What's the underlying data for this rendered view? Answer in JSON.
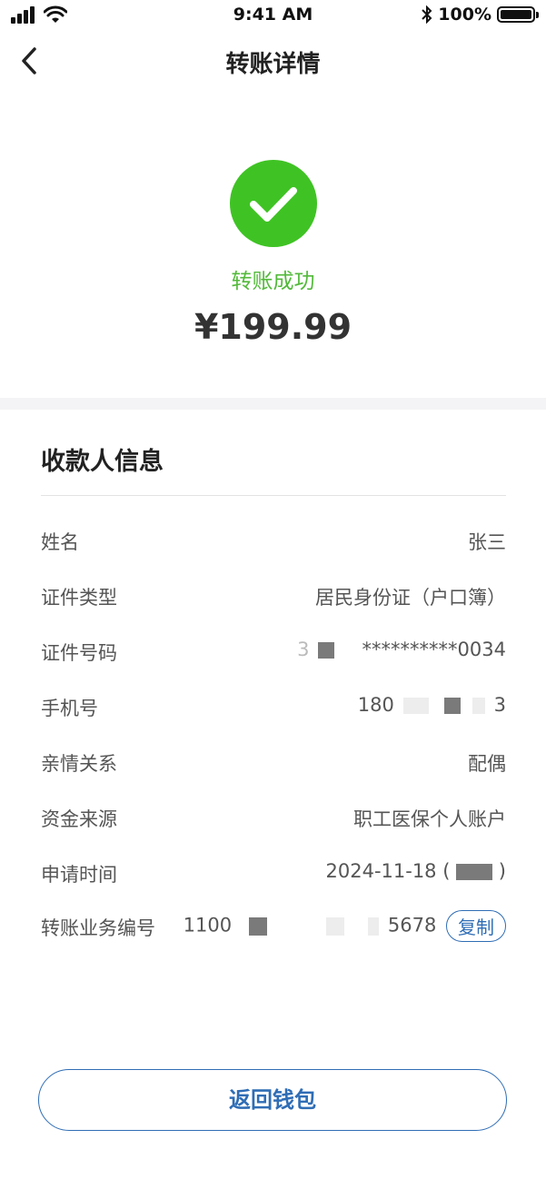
{
  "status_bar": {
    "time": "9:41 AM",
    "battery_percent": "100%",
    "battery_level": 1.0
  },
  "nav": {
    "title": "转账详情"
  },
  "result": {
    "status": "转账成功",
    "amount": "¥199.99"
  },
  "payee_section": {
    "title": "收款人信息"
  },
  "rows": [
    {
      "label": "姓名",
      "value": "张三"
    },
    {
      "label": "证件类型",
      "value": "居民身份证（户口簿）"
    },
    {
      "label": "证件号码",
      "value_prefix": "3",
      "value_suffix": "**********0034"
    },
    {
      "label": "手机号",
      "value_prefix": "180",
      "value_suffix": "3"
    },
    {
      "label": "亲情关系",
      "value": "配偶"
    },
    {
      "label": "资金来源",
      "value": "职工医保个人账户"
    },
    {
      "label": "申请时间",
      "value_prefix": "2024-11-18 (",
      "value_suffix": ")"
    },
    {
      "label": "转账业务编号",
      "value_prefix": "1100",
      "value_suffix": "5678",
      "action": "复制"
    }
  ],
  "footer": {
    "button_label": "返回钱包"
  },
  "colors": {
    "success": "#3fc324",
    "accent": "#2f6db5",
    "band": "#f4f4f6"
  }
}
